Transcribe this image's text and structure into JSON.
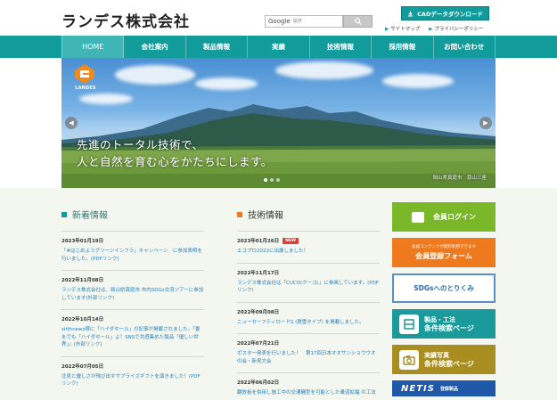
{
  "header": {
    "logo": "ランデス株式会社",
    "search": {
      "engine_label": "Google",
      "placeholder": "提供"
    },
    "cad_button": "CADデータダウンロード",
    "links": [
      "サイトマップ",
      "プライバシーポリシー"
    ]
  },
  "nav": {
    "items": [
      {
        "label": "HOME",
        "active": true
      },
      {
        "label": "会社案内"
      },
      {
        "label": "製品情報"
      },
      {
        "label": "実績"
      },
      {
        "label": "技術情報"
      },
      {
        "label": "採用情報"
      },
      {
        "label": "お問い合わせ"
      }
    ]
  },
  "hero": {
    "logo_text": "LANDES",
    "line1": "先進のトータル技術で、",
    "line2": "人と自然を育む心をかたちにします。",
    "caption": "岡山県真庭市　蒜山三座",
    "slide_count": 3,
    "active_slide": 1
  },
  "news": {
    "title": "新着情報",
    "entries": [
      {
        "date": "2023年01月19日",
        "text": "「#はじめようグリーンインフラ」キャンペーン　に参加表明を行いました。(PDFリンク)"
      },
      {
        "date": "2022年11月08日",
        "text": "ランデス株式会社は、岡山県真庭市 市内SDGs交流ツアーに参加しています(外部リンク)"
      },
      {
        "date": "2022年10月14日",
        "text": "sitthnews様に「ハイダセール」の記事が掲載されました。『畳をでも「ハイダセール」よ！SNSで共感集めた製品「優しい世界」』(外部リンク)"
      },
      {
        "date": "2022年07月05日",
        "text": "北見と優しさが飛び出すサプライズギフトを演きました！(PDFリンク)"
      }
    ]
  },
  "tech": {
    "title": "技術情報",
    "new_badge": "NEW",
    "entries": [
      {
        "date": "2023年01月26日",
        "is_new": true,
        "text": "エコプロ2022に出展しました！"
      },
      {
        "date": "2022年11月17日",
        "text": "ランデス株式会社は「CUCO(クーコ)」に参画しています。(PDFリンク)"
      },
      {
        "date": "2022年09月08日",
        "text": "ニューセーフティロードS (積雪タイプ) を掲載しました。"
      },
      {
        "date": "2022年07月21日",
        "text": "ポスター発表を行いました！　第17回日本オオサンショウウオの会・新見大会"
      },
      {
        "date": "2022年06月02日",
        "text": "翻放板を併用し施工中の交通騒型を可能とした乗道拡幅 の工法"
      }
    ]
  },
  "side": {
    "login": "会員ログイン",
    "register_small": "会員コンテンツが無料利用できます",
    "register": "会員登録フォーム",
    "sdgs": "SDGsへのとりくみ",
    "product_search_1": "製品・工法",
    "product_search_2": "条件検索ページ",
    "photo_search_1": "実績写真",
    "photo_search_2": "条件検索ページ",
    "netis": "NETIS",
    "netis_small": "登録製品"
  },
  "colors": {
    "teal": "#129b9b",
    "green": "#7ab829",
    "orange": "#ee7a1d",
    "olive": "#a88d20",
    "blue": "#1f58a8"
  }
}
